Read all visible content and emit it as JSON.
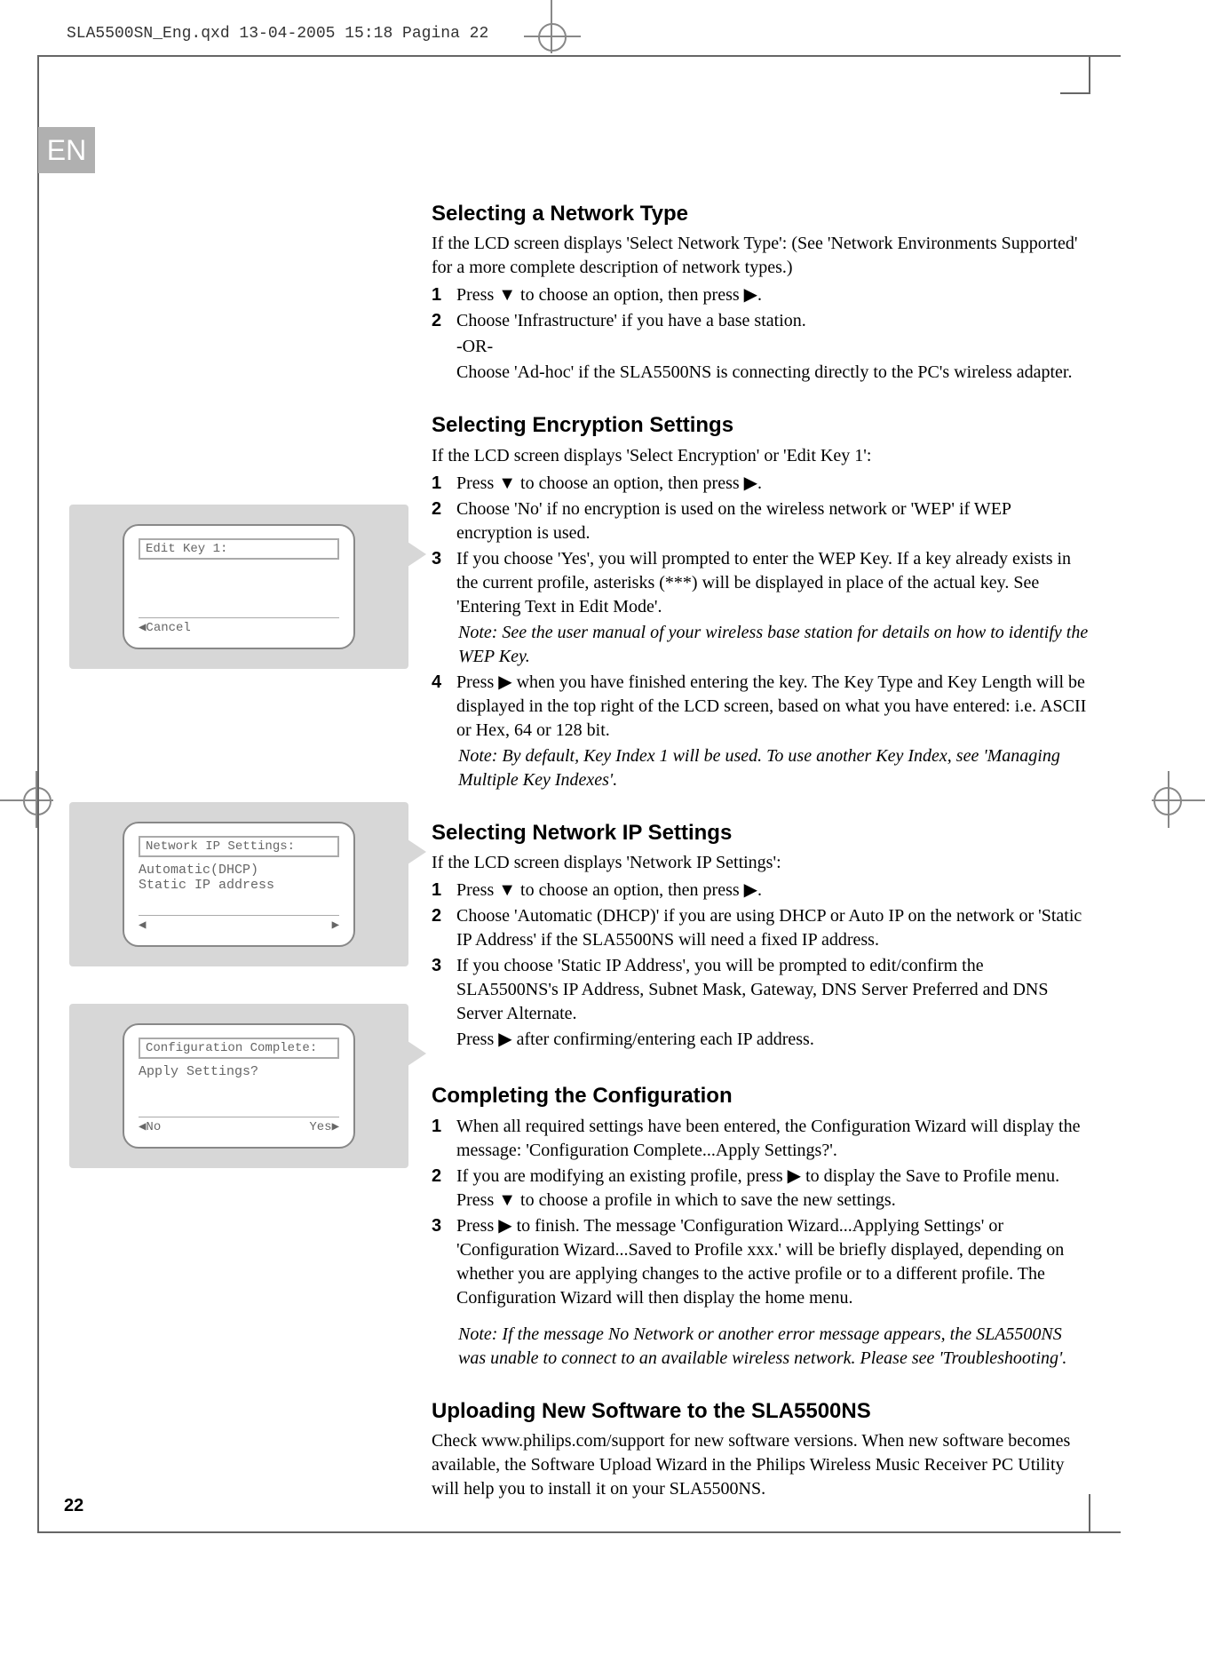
{
  "header": "SLA5500SN_Eng.qxd  13-04-2005  15:18  Pagina 22",
  "lang_tab": "EN",
  "page_number": "22",
  "sections": {
    "network_type": {
      "heading": "Selecting a Network Type",
      "intro": "If the LCD screen displays 'Select Network Type': (See 'Network Environments Supported' for a more complete description of network types.)",
      "steps": [
        {
          "n": "1",
          "t": "Press ▼ to choose an option, then press ▶."
        },
        {
          "n": "2",
          "t": "Choose 'Infrastructure' if you have a base station."
        }
      ],
      "or_line": "-OR-",
      "or_text": "Choose 'Ad-hoc' if the SLA5500NS is connecting directly to the PC's wireless adapter."
    },
    "encryption": {
      "heading": "Selecting Encryption Settings",
      "intro": "If the LCD screen displays 'Select Encryption' or 'Edit Key 1':",
      "steps": [
        {
          "n": "1",
          "t": "Press ▼ to choose an option, then press ▶."
        },
        {
          "n": "2",
          "t": "Choose 'No' if no encryption is used on the wireless network or 'WEP' if WEP encryption is used."
        },
        {
          "n": "3",
          "t": "If you choose 'Yes', you will prompted to enter the WEP Key. If a key already exists in the current profile, asterisks (***) will be displayed in place of the actual key. See 'Entering Text in Edit Mode'."
        }
      ],
      "note1": "Note: See the user manual of your wireless base station for details on how to identify the WEP Key.",
      "step4": {
        "n": "4",
        "t": "Press ▶ when you have finished entering the key. The Key Type and Key Length will be displayed in the top right of the LCD screen, based on what you have entered: i.e. ASCII or Hex, 64 or 128 bit."
      },
      "note2": "Note: By default, Key Index 1 will be used. To use another Key Index, see 'Managing Multiple Key Indexes'."
    },
    "ip": {
      "heading": "Selecting Network IP Settings",
      "intro": "If the LCD screen displays 'Network IP Settings':",
      "steps": [
        {
          "n": "1",
          "t": "Press ▼ to choose an option, then press ▶."
        },
        {
          "n": "2",
          "t": "Choose 'Automatic (DHCP)' if you are using DHCP or Auto IP on the network or 'Static IP Address' if the SLA5500NS will need a fixed IP address."
        },
        {
          "n": "3",
          "t": "If you choose 'Static IP Address', you will be prompted to edit/confirm the SLA5500NS's IP Address, Subnet Mask, Gateway, DNS Server Preferred and DNS Server Alternate."
        }
      ],
      "tail": "Press ▶ after confirming/entering each IP address."
    },
    "complete": {
      "heading": "Completing the Configuration",
      "steps": [
        {
          "n": "1",
          "t": "When all required settings have been entered, the Configuration Wizard will display the message: 'Configuration Complete...Apply Settings?'."
        },
        {
          "n": "2",
          "t": "If you are modifying an existing profile, press ▶ to display the Save to Profile menu. Press ▼ to choose a profile in which to save the new settings."
        },
        {
          "n": "3",
          "t": "Press ▶ to finish. The message 'Configuration Wizard...Applying Settings' or 'Configuration Wizard...Saved to Profile xxx.' will be briefly displayed, depending on whether you are applying changes to the active profile or to a different profile. The Configuration Wizard will then display the home menu."
        }
      ],
      "note": "Note: If the message No Network or another error message appears, the SLA5500NS was unable to connect to an available wireless network. Please see 'Troubleshooting'."
    },
    "upload": {
      "heading": "Uploading New Software to the SLA5500NS",
      "text": "Check www.philips.com/support for new software versions. When new software becomes available, the Software Upload Wizard in the Philips Wireless Music Receiver PC Utility will help you to install it on your SLA5500NS."
    }
  },
  "lcd1": {
    "title": "Edit Key 1:",
    "bottom_left": "◀Cancel",
    "bottom_right": ""
  },
  "lcd2": {
    "title": "Network IP Settings:",
    "line1": "Automatic(DHCP)",
    "line2": "Static IP address",
    "bottom_left": "◀",
    "bottom_right": "▶"
  },
  "lcd3": {
    "title": "Configuration Complete:",
    "line1": "Apply Settings?",
    "bottom_left": "◀No",
    "bottom_right": "Yes▶"
  }
}
